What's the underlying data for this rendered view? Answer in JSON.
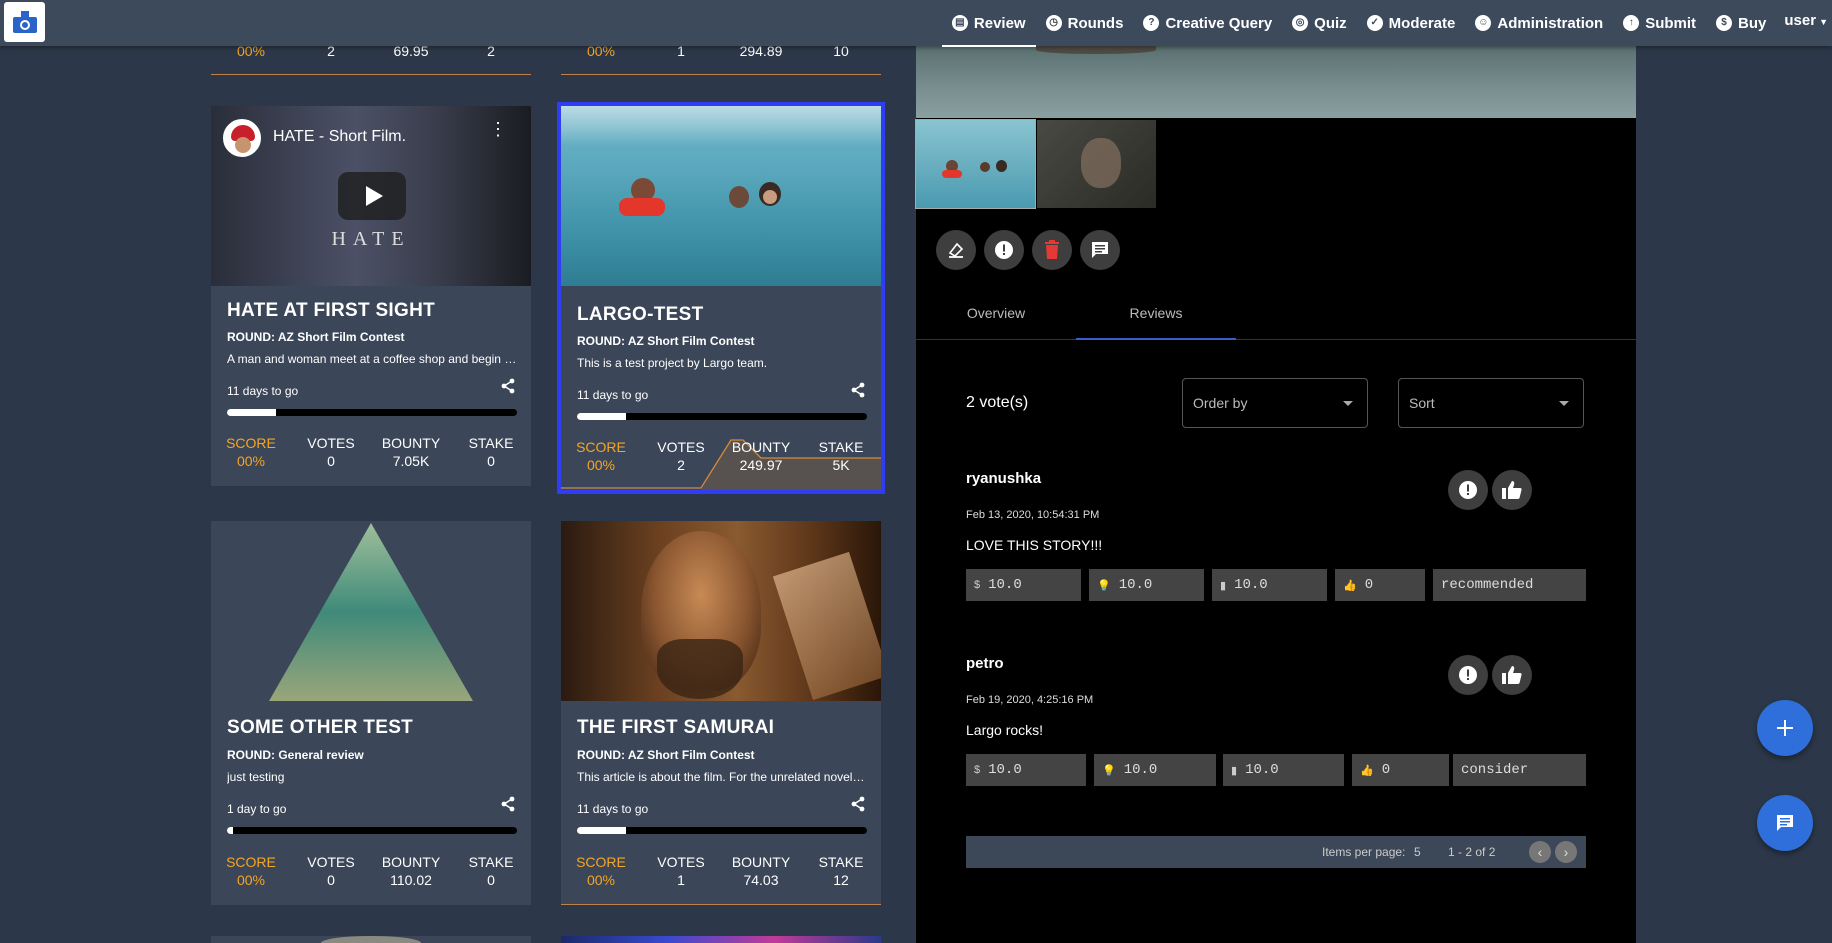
{
  "nav": {
    "items": [
      {
        "label": "Review",
        "icon": "review-icon",
        "active": true
      },
      {
        "label": "Rounds",
        "icon": "rounds-icon"
      },
      {
        "label": "Creative Query",
        "icon": "creative-query-icon"
      },
      {
        "label": "Quiz",
        "icon": "quiz-icon"
      },
      {
        "label": "Moderate",
        "icon": "moderate-icon"
      },
      {
        "label": "Administration",
        "icon": "administration-icon"
      },
      {
        "label": "Submit",
        "icon": "submit-icon"
      },
      {
        "label": "Buy",
        "icon": "buy-icon"
      }
    ],
    "user": "user"
  },
  "stat_labels": {
    "score": "SCORE",
    "votes": "VOTES",
    "bounty": "BOUNTY",
    "stake": "STAKE"
  },
  "top_partial": [
    {
      "score": "00%",
      "votes": "2",
      "bounty": "69.95",
      "stake": "2"
    },
    {
      "score": "00%",
      "votes": "1",
      "bounty": "294.89",
      "stake": "10"
    }
  ],
  "cards": [
    {
      "video_title": "HATE - Short Film.",
      "video_overlay": "HATE",
      "title": "HATE AT FIRST SIGHT",
      "round": "ROUND: AZ Short Film Contest",
      "desc": "A man and woman meet at a coffee shop and begin to talk.",
      "days": "11 days to go",
      "progress": 0.17,
      "score": "00%",
      "votes": "0",
      "bounty": "7.05K",
      "stake": "0"
    },
    {
      "title": "LARGO-TEST",
      "round": "ROUND: AZ Short Film Contest",
      "desc": "This is a test project by Largo team.",
      "days": "11 days to go",
      "progress": 0.17,
      "score": "00%",
      "votes": "2",
      "bounty": "249.97",
      "stake": "5K"
    },
    {
      "title": "SOME OTHER TEST",
      "round": "ROUND: General review",
      "desc": "just testing",
      "days": "1 day to go",
      "progress": 0.02,
      "score": "00%",
      "votes": "0",
      "bounty": "110.02",
      "stake": "0"
    },
    {
      "title": "THE FIRST SAMURAI",
      "round": "ROUND: AZ Short Film Contest",
      "desc": "This article is about the film. For the unrelated novel, see The Last Samurai.",
      "days": "11 days to go",
      "progress": 0.17,
      "score": "00%",
      "votes": "1",
      "bounty": "74.03",
      "stake": "12"
    }
  ],
  "panel": {
    "tabs": [
      "Overview",
      "Reviews"
    ],
    "votes_count": "2 vote(s)",
    "order_by": "Order by",
    "sort": "Sort",
    "reviews": [
      {
        "user": "ryanushka",
        "date": "Feb 13, 2020, 10:54:31 PM",
        "text": "LOVE THIS STORY!!!",
        "f1": "10.0",
        "f2": "10.0",
        "f3": "10.0",
        "f4": "0",
        "f5": "recommended"
      },
      {
        "user": "petro",
        "date": "Feb 19, 2020, 4:25:16 PM",
        "text": "Largo rocks!",
        "f1": "10.0",
        "f2": "10.0",
        "f3": "10.0",
        "f4": "0",
        "f5": "consider"
      }
    ],
    "pager": {
      "label": "Items per page:",
      "value": "5",
      "range": "1 - 2 of 2"
    }
  },
  "colors": {
    "accent": "#f5a623",
    "selected": "#2f3ef5",
    "fab": "#2f6fdb"
  }
}
